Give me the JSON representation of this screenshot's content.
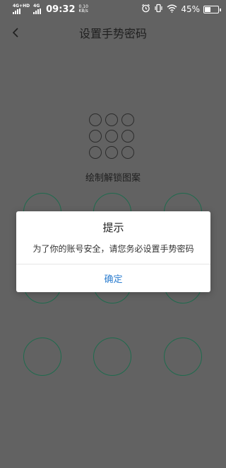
{
  "status_bar": {
    "sim1_tag": "4G+HD",
    "sim2_tag": "4G",
    "time": "09:32",
    "speed_value": "0.10",
    "speed_unit": "KB/s",
    "battery_pct": "45%",
    "battery_level": 0.45,
    "icons": [
      "signal-icon",
      "alarm-icon",
      "vibrate-icon",
      "wifi-icon",
      "battery-icon"
    ]
  },
  "nav": {
    "back_icon": "chevron-left-icon",
    "title": "设置手势密码"
  },
  "pattern_setup": {
    "hint": "绘制解锁图案",
    "preview_grid": "3x3",
    "node_count": 9,
    "ring_color": "#1f6b4e"
  },
  "dialog": {
    "title": "提示",
    "message": "为了你的账号安全，请您务必设置手势密码",
    "confirm_label": "确定",
    "accent_color": "#2f7fd0"
  }
}
